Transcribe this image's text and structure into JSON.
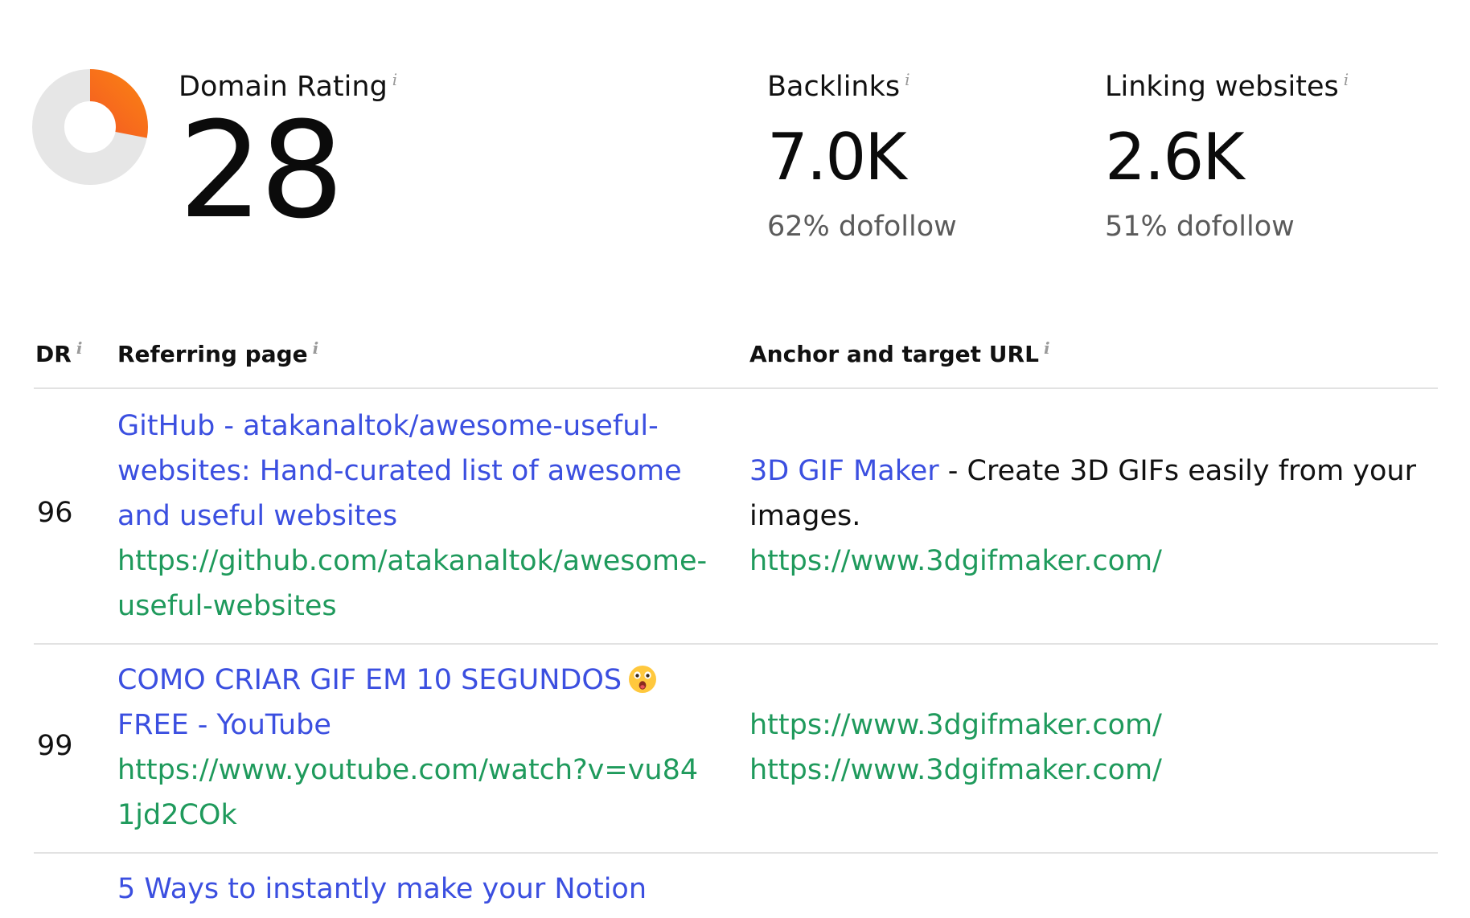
{
  "stats": {
    "domain_rating": {
      "label": "Domain Rating",
      "value": "28",
      "gauge_fraction": 0.28,
      "gauge_colors": [
        "#f03e2f",
        "#f97a16"
      ],
      "gauge_track_color": "#e6e6e6"
    },
    "backlinks": {
      "label": "Backlinks",
      "value": "7.0K",
      "sub": "62% dofollow"
    },
    "linking_websites": {
      "label": "Linking websites",
      "value": "2.6K",
      "sub": "51% dofollow"
    },
    "info_icon": "i"
  },
  "table": {
    "headers": {
      "dr": "DR",
      "referring_page": "Referring page",
      "anchor_target": "Anchor and target URL"
    },
    "rows": [
      {
        "dr": "96",
        "ref_title": "GitHub - atakanaltok/awesome-useful-websites: Hand-curated list of awesome and useful websites",
        "ref_url": "https://github.com/atakanaltok/awesome-useful-websites",
        "anchor_link": "3D GIF Maker",
        "anchor_text": " - Create 3D GIFs easily from your images.",
        "target_url": "https://www.3dgifmaker.com/"
      },
      {
        "dr": "99",
        "ref_title": "COMO CRIAR GIF EM 10 SEGUNDOS",
        "ref_title_icon": "astonished-face-emoji",
        "ref_title_after": "FREE - YouTube",
        "ref_url": "https://www.youtube.com/watch?v=vu841jd2COk",
        "anchor_link": "https://www.3dgifmaker.com/",
        "target_url": "https://www.3dgifmaker.com/"
      },
      {
        "ref_title": "5 Ways to instantly make your Notion"
      }
    ]
  },
  "colors": {
    "link_blue": "#3b4fe0",
    "link_green": "#1f9a5c",
    "divider": "#e2e2e2"
  }
}
